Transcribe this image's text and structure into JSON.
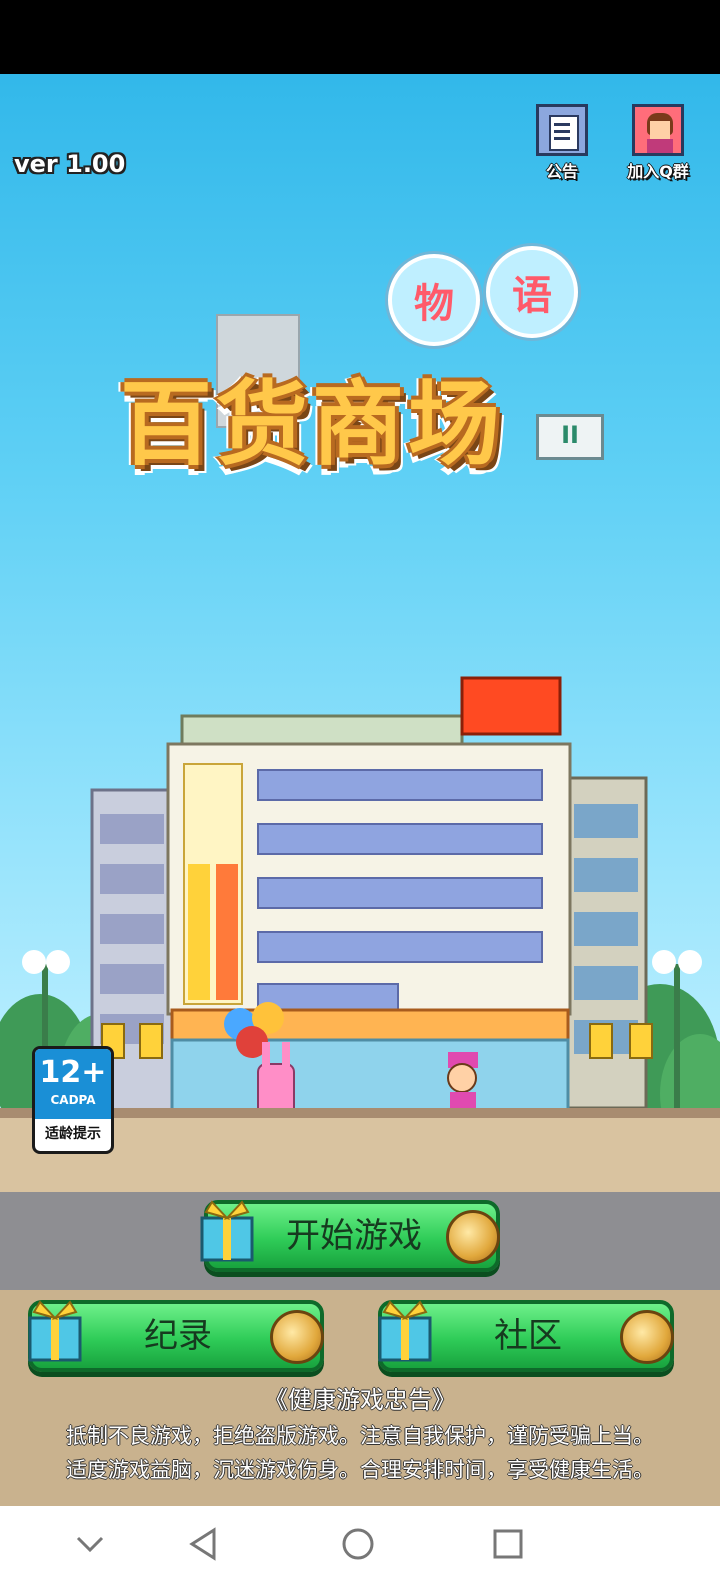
{
  "version": "ver 1.00",
  "top_buttons": {
    "notice_label": "公告",
    "qq_label": "加入Q群"
  },
  "logo": {
    "title": "百货商场",
    "bubble1": "物",
    "bubble2": "语",
    "badge": "II"
  },
  "age_rating": {
    "value": "12+",
    "org": "CADPA",
    "caption": "适龄提示"
  },
  "buttons": {
    "start": "开始游戏",
    "records": "纪录",
    "community": "社区"
  },
  "notice": {
    "title": "《健康游戏忠告》",
    "line1": "抵制不良游戏，拒绝盗版游戏。注意自我保护，谨防受骗上当。",
    "line2": "适度游戏益脑，沉迷游戏伤身。合理安排时间，享受健康生活。"
  },
  "navbar": {
    "icons": [
      "chevron-down-icon",
      "back-icon",
      "home-icon",
      "recents-icon"
    ]
  }
}
